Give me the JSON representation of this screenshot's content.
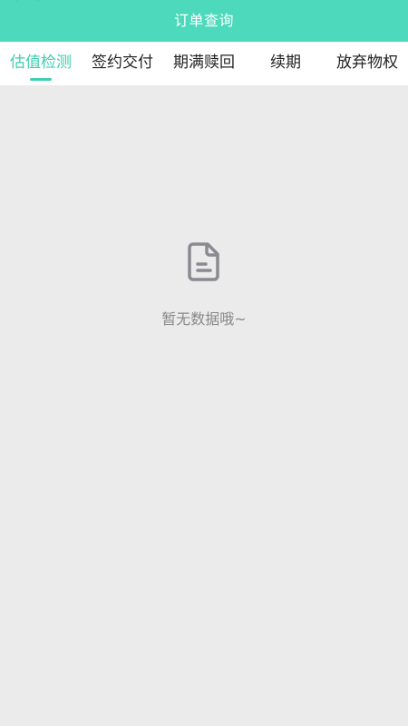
{
  "header": {
    "title": "订单查询",
    "back_icon": "back-arrow-icon"
  },
  "tabs": [
    {
      "label": "估值检测",
      "active": true
    },
    {
      "label": "签约交付",
      "active": false
    },
    {
      "label": "期满赎回",
      "active": false
    },
    {
      "label": "续期",
      "active": false
    },
    {
      "label": "放弃物权",
      "active": false
    }
  ],
  "empty_state": {
    "icon": "document-icon",
    "text": "暂无数据哦~"
  },
  "colors": {
    "header_bg": "#4dd9bb",
    "accent": "#3ecfb0",
    "page_bg": "#ebebeb"
  }
}
